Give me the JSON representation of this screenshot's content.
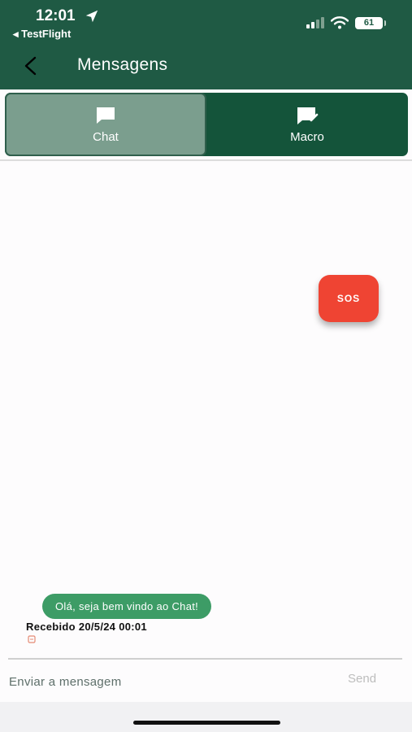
{
  "status_bar": {
    "time": "12:01",
    "back_app": "◂ TestFlight",
    "battery": "61"
  },
  "header": {
    "title": "Mensagens"
  },
  "tabs": [
    {
      "label": "Chat",
      "icon": "chat-bubble-icon",
      "selected": true
    },
    {
      "label": "Macro",
      "icon": "message-check-icon",
      "selected": false
    }
  ],
  "sos": {
    "label": "SOS",
    "color": "#ef4433"
  },
  "messages": [
    {
      "text": "Olá, seja bem vindo ao Chat!",
      "status": "Recebido 20/5/24 00:01"
    }
  ],
  "composer": {
    "placeholder": "Enviar a mensagem",
    "send_label": "Send"
  },
  "colors": {
    "header": "#1f5a44",
    "tab_selected": "#7b9e8e",
    "tab_bar": "#14543a",
    "bubble": "#3d9c66"
  }
}
